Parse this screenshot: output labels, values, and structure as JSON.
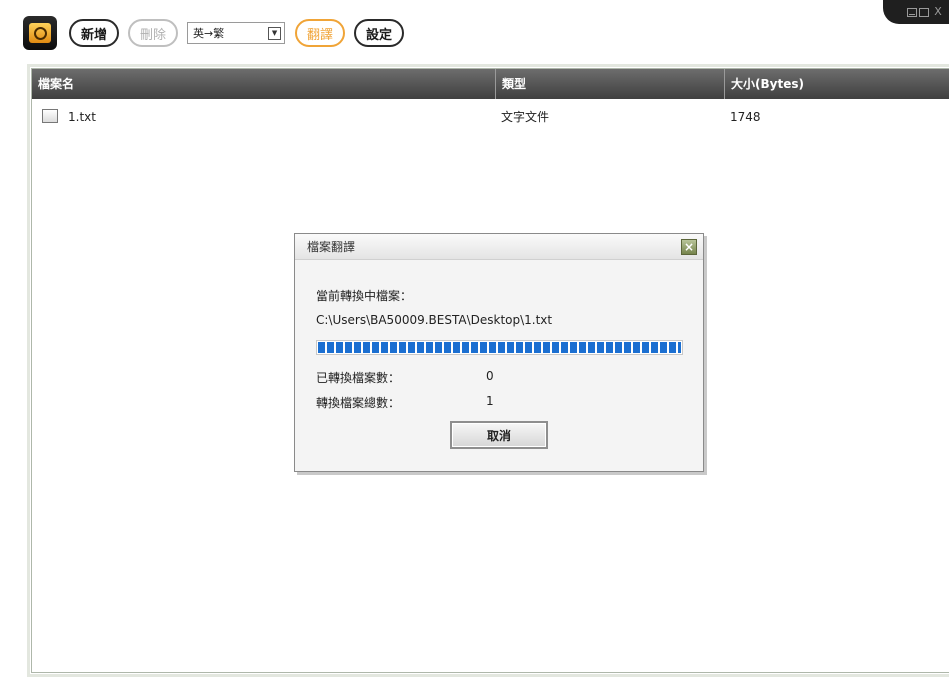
{
  "window_controls": {
    "minimize_icon": "minimize-icon",
    "maximize_icon": "maximize-icon",
    "close_symbol": "X"
  },
  "toolbar": {
    "logo_icon": "camera-lens-icon",
    "add_label": "新增",
    "delete_label": "刪除",
    "language_select": {
      "value": "英→繁",
      "dropdown_icon": "chevron-down-icon"
    },
    "translate_label": "翻譯",
    "settings_label": "設定"
  },
  "file_table": {
    "columns": [
      "檔案名",
      "類型",
      "大小(Bytes)"
    ],
    "rows": [
      {
        "icon": "text-file-icon",
        "name": "1.txt",
        "type": "文字文件",
        "size": "1748"
      }
    ]
  },
  "dialog": {
    "title": "檔案翻譯",
    "close_icon": "close-icon",
    "current_label": "當前轉換中檔案：",
    "current_path": "C:\\Users\\BA50009.BESTA\\Desktop\\1.txt",
    "progress": 1.0,
    "converted_label": "已轉換檔案數：",
    "converted_value": "0",
    "total_label": "轉換檔案總數：",
    "total_value": "1",
    "cancel_label": "取消"
  },
  "colors": {
    "header_bg": "#4f4f4f",
    "progress": "#1b6fd1",
    "accent_orange": "#f0a437"
  }
}
